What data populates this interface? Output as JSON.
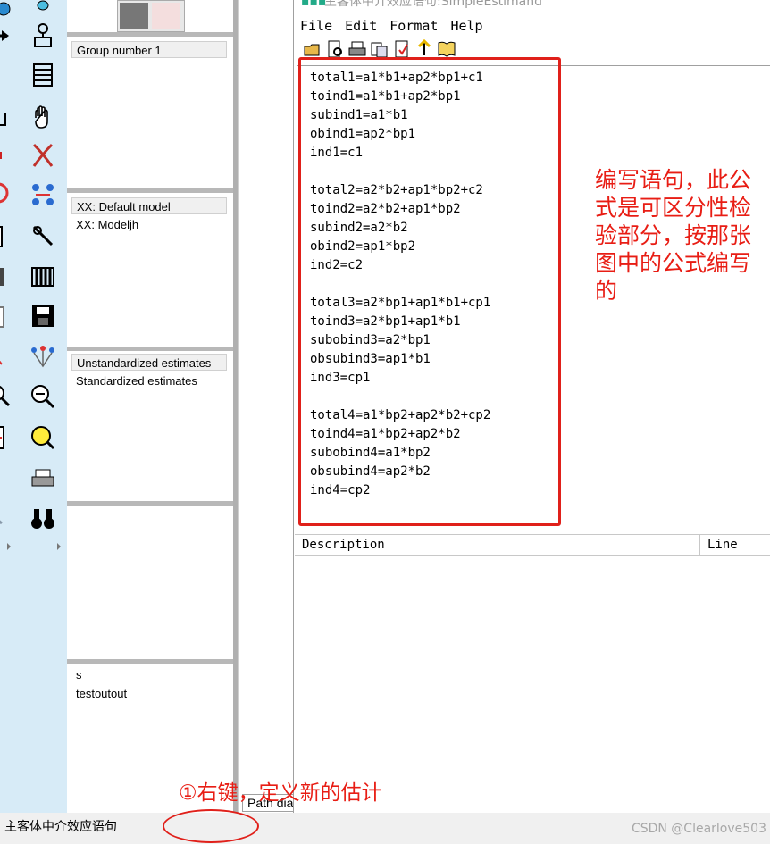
{
  "left_panels": {
    "groups": [
      "Group number 1"
    ],
    "models": [
      "XX: Default model",
      "XX: Modeljh"
    ],
    "estimates": [
      "Unstandardized estimates",
      "Standardized estimates"
    ],
    "files": [
      "s",
      "testoutout"
    ]
  },
  "editor": {
    "title": "主客体中介效应语句:SimpleEstimand",
    "menu": [
      "File",
      "Edit",
      "Format",
      "Help"
    ],
    "lines": [
      "total1=a1*b1+ap2*bp1+c1",
      "toind1=a1*b1+ap2*bp1",
      "subind1=a1*b1",
      "obind1=ap2*bp1",
      "ind1=c1",
      "",
      "total2=a2*b2+ap1*bp2+c2",
      "toind2=a2*b2+ap1*bp2",
      "subind2=a2*b2",
      "obind2=ap1*bp2",
      "ind2=c2",
      "",
      "total3=a2*bp1+ap1*b1+cp1",
      "toind3=a2*bp1+ap1*b1",
      "subobind3=a2*bp1",
      "obsubind3=ap1*b1",
      "ind3=cp1",
      "",
      "total4=a1*bp2+ap2*b2+cp2",
      "toind4=a1*bp2+ap2*b2",
      "subobind4=a1*bp2",
      "obsubind4=ap2*b2",
      "ind4=cp2"
    ],
    "description_col": "Description",
    "line_col": "Line"
  },
  "annotation": "编写语句，此公式是可区分性检验部分，按那张图中的公式编写的",
  "step_annotation": "①右键，定义新的估计",
  "status_text": "主客体中介效应语句",
  "path_tab": "Path diagram",
  "watermark": "CSDN @Clearlove503",
  "colors": {
    "toolbar_bg": "#d7ebf7",
    "annotation_red": "#e81d14"
  }
}
